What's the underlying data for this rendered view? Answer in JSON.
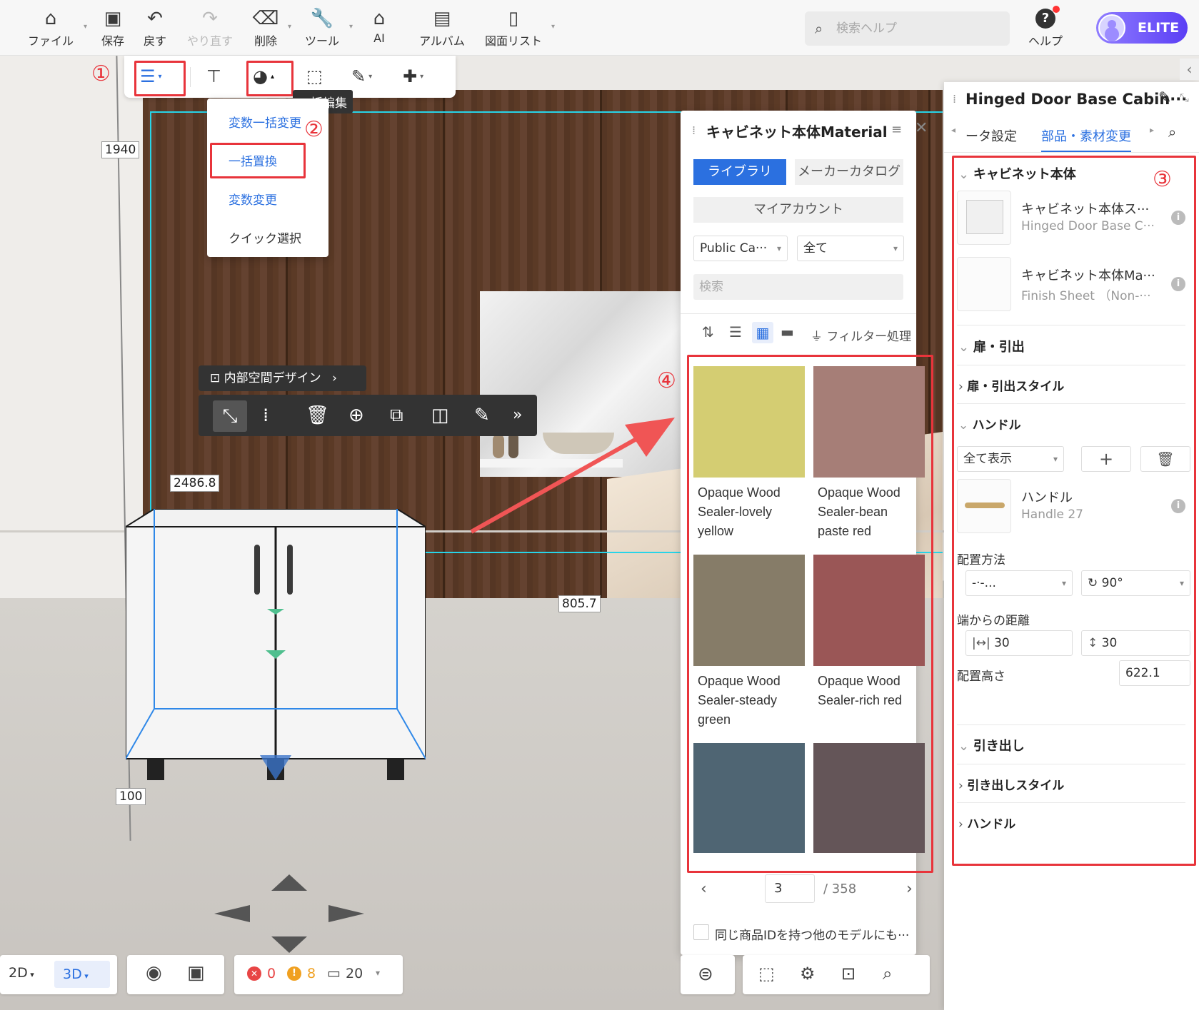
{
  "menubar": {
    "items": [
      {
        "label": "ファイル",
        "icon": "home-icon"
      },
      {
        "label": "保存",
        "icon": "save-icon"
      },
      {
        "label": "戻す",
        "icon": "undo-icon"
      },
      {
        "label": "やり直す",
        "icon": "redo-icon",
        "disabled": true
      },
      {
        "label": "削除",
        "icon": "eraser-icon"
      },
      {
        "label": "ツール",
        "icon": "wrench-icon"
      },
      {
        "label": "AI",
        "icon": "ai-house-icon"
      },
      {
        "label": "アルバム",
        "icon": "album-icon"
      },
      {
        "label": "図面リスト",
        "icon": "drawing-list-icon"
      }
    ],
    "search_placeholder": "検索ヘルプ",
    "help_label": "ヘルプ",
    "badge": "ELITE"
  },
  "toolbar": {
    "tooltip": "一括編集",
    "annotation_1": "①",
    "annotation_2": "②",
    "annotation_3": "③",
    "annotation_4": "④"
  },
  "dropdown": {
    "items": [
      "変数一括変更",
      "一括置換",
      "変数変更",
      "クイック選択"
    ],
    "highlighted": "一括置換"
  },
  "scene": {
    "dimensions": [
      "1940",
      "2486.8",
      "805.7",
      "100"
    ],
    "inner_design_label": "内部空間デザイン"
  },
  "material_panel": {
    "title": "キャビネット本体Material",
    "tabs": {
      "library": "ライブラリ",
      "catalog": "メーカーカタログ",
      "account": "マイアカウント"
    },
    "select1": "Public Ca···",
    "select2": "全て",
    "search_placeholder": "検索",
    "filter_label": "フィルター処理",
    "swatches": [
      {
        "name": "Opaque Wood Sealer-lovely yellow",
        "color": "#d4cd72"
      },
      {
        "name": "Opaque Wood Sealer-bean paste red",
        "color": "#a67e77"
      },
      {
        "name": "Opaque Wood Sealer-steady green",
        "color": "#867c68"
      },
      {
        "name": "Opaque Wood Sealer-rich red",
        "color": "#9a5656"
      },
      {
        "name": "",
        "color": "#4f6573"
      },
      {
        "name": "",
        "color": "#645558"
      }
    ],
    "swatch_lines": [
      [
        "Opaque Wood",
        "Sealer-lovely",
        "yellow"
      ],
      [
        "Opaque Wood",
        "Sealer-bean",
        "paste red"
      ],
      [
        "Opaque Wood",
        "Sealer-steady",
        "green"
      ],
      [
        "Opaque Wood",
        "Sealer-rich red"
      ]
    ],
    "page_current": "3",
    "page_total": "/ 358",
    "apply_same_id": "同じ商品IDを持つ他のモデルにも···"
  },
  "prop_panel": {
    "title": "Hinged Door Base Cabin···",
    "tab_left": "ータ設定",
    "tab_active": "部品・素材変更",
    "sections": {
      "cabinet_body": "キャビネット本体",
      "door_drawer": "扉・引出",
      "door_style": "扉・引出スタイル",
      "handle": "ハンドル",
      "drawer": "引き出し",
      "drawer_style": "引き出しスタイル",
      "drawer_handle": "ハンドル"
    },
    "items": [
      {
        "title": "キャビネット本体ス···",
        "sub": "Hinged Door Base C···"
      },
      {
        "title": "キャビネット本体Ma···",
        "sub": "Finish Sheet （Non-···"
      },
      {
        "title": "ハンドル",
        "sub": "Handle 27"
      }
    ],
    "show_all": "全て表示",
    "placement_label": "配置方法",
    "placement_value": "-·-...",
    "rotation_value": "90°",
    "edge_distance_label": "端からの距離",
    "edge_h": "30",
    "edge_v": "30",
    "height_label": "配置高さ",
    "height_value": "622.1"
  },
  "bottom": {
    "view2d": "2D",
    "view3d": "3D",
    "errors": "0",
    "warnings": "8",
    "objects": "20"
  }
}
